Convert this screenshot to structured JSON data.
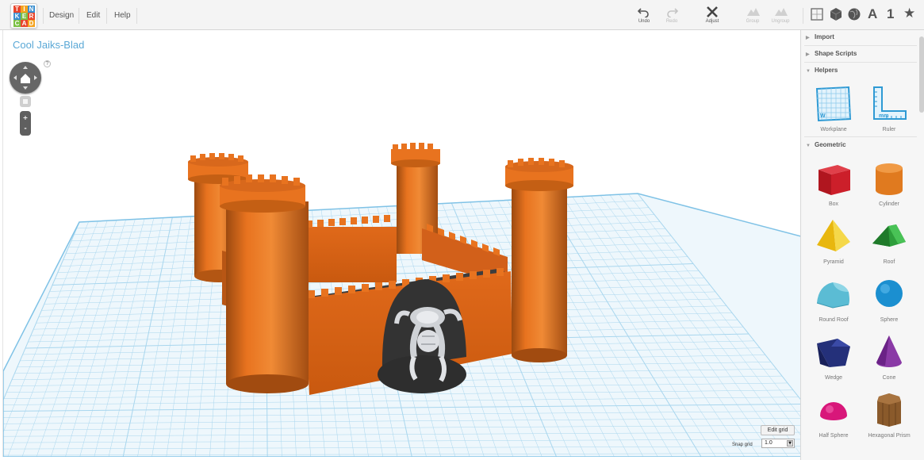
{
  "app": {
    "logo_letters": [
      "T",
      "I",
      "N",
      "K",
      "E",
      "R",
      "C",
      "A",
      "D"
    ],
    "menu": [
      "Design",
      "Edit",
      "Help"
    ]
  },
  "toolbar": {
    "undo": "Undo",
    "redo": "Redo",
    "adjust": "Adjust",
    "group": "Group",
    "ungroup": "Ungroup"
  },
  "view_buttons": {
    "text_label": "A",
    "number_label": "1",
    "star_icon": "star-icon"
  },
  "design": {
    "title": "Cool Jaiks-Blad"
  },
  "navigation": {
    "help": "?",
    "zoom_in": "+",
    "zoom_out": "-"
  },
  "grid": {
    "edit_grid": "Edit grid",
    "snap_label": "Snap grid",
    "snap_value": "1.0"
  },
  "sidebar": {
    "import": "Import",
    "shape_scripts": "Shape Scripts",
    "helpers": "Helpers",
    "helper_items": [
      "Workplane",
      "Ruler"
    ],
    "geometric": "Geometric",
    "geometric_items": [
      "Box",
      "Cylinder",
      "Pyramid",
      "Roof",
      "Round Roof",
      "Sphere",
      "Wedge",
      "Cone",
      "Half Sphere",
      "Hexagonal Prism"
    ]
  },
  "colors": {
    "castle": "#e8731f",
    "grid_line": "#a8d6ee",
    "workplane": "#eef7fc",
    "title_blue": "#5aa8d6",
    "box": "#cc1f2a",
    "cylinder": "#e07a1f",
    "pyramid": "#f2cf1a",
    "roof": "#2e9e3b",
    "round_roof": "#5bbcd4",
    "sphere": "#1b8fd0",
    "wedge": "#24307a",
    "cone": "#8a3aa6",
    "half_sphere": "#d8177a",
    "hex_prism": "#8a5a2b"
  }
}
